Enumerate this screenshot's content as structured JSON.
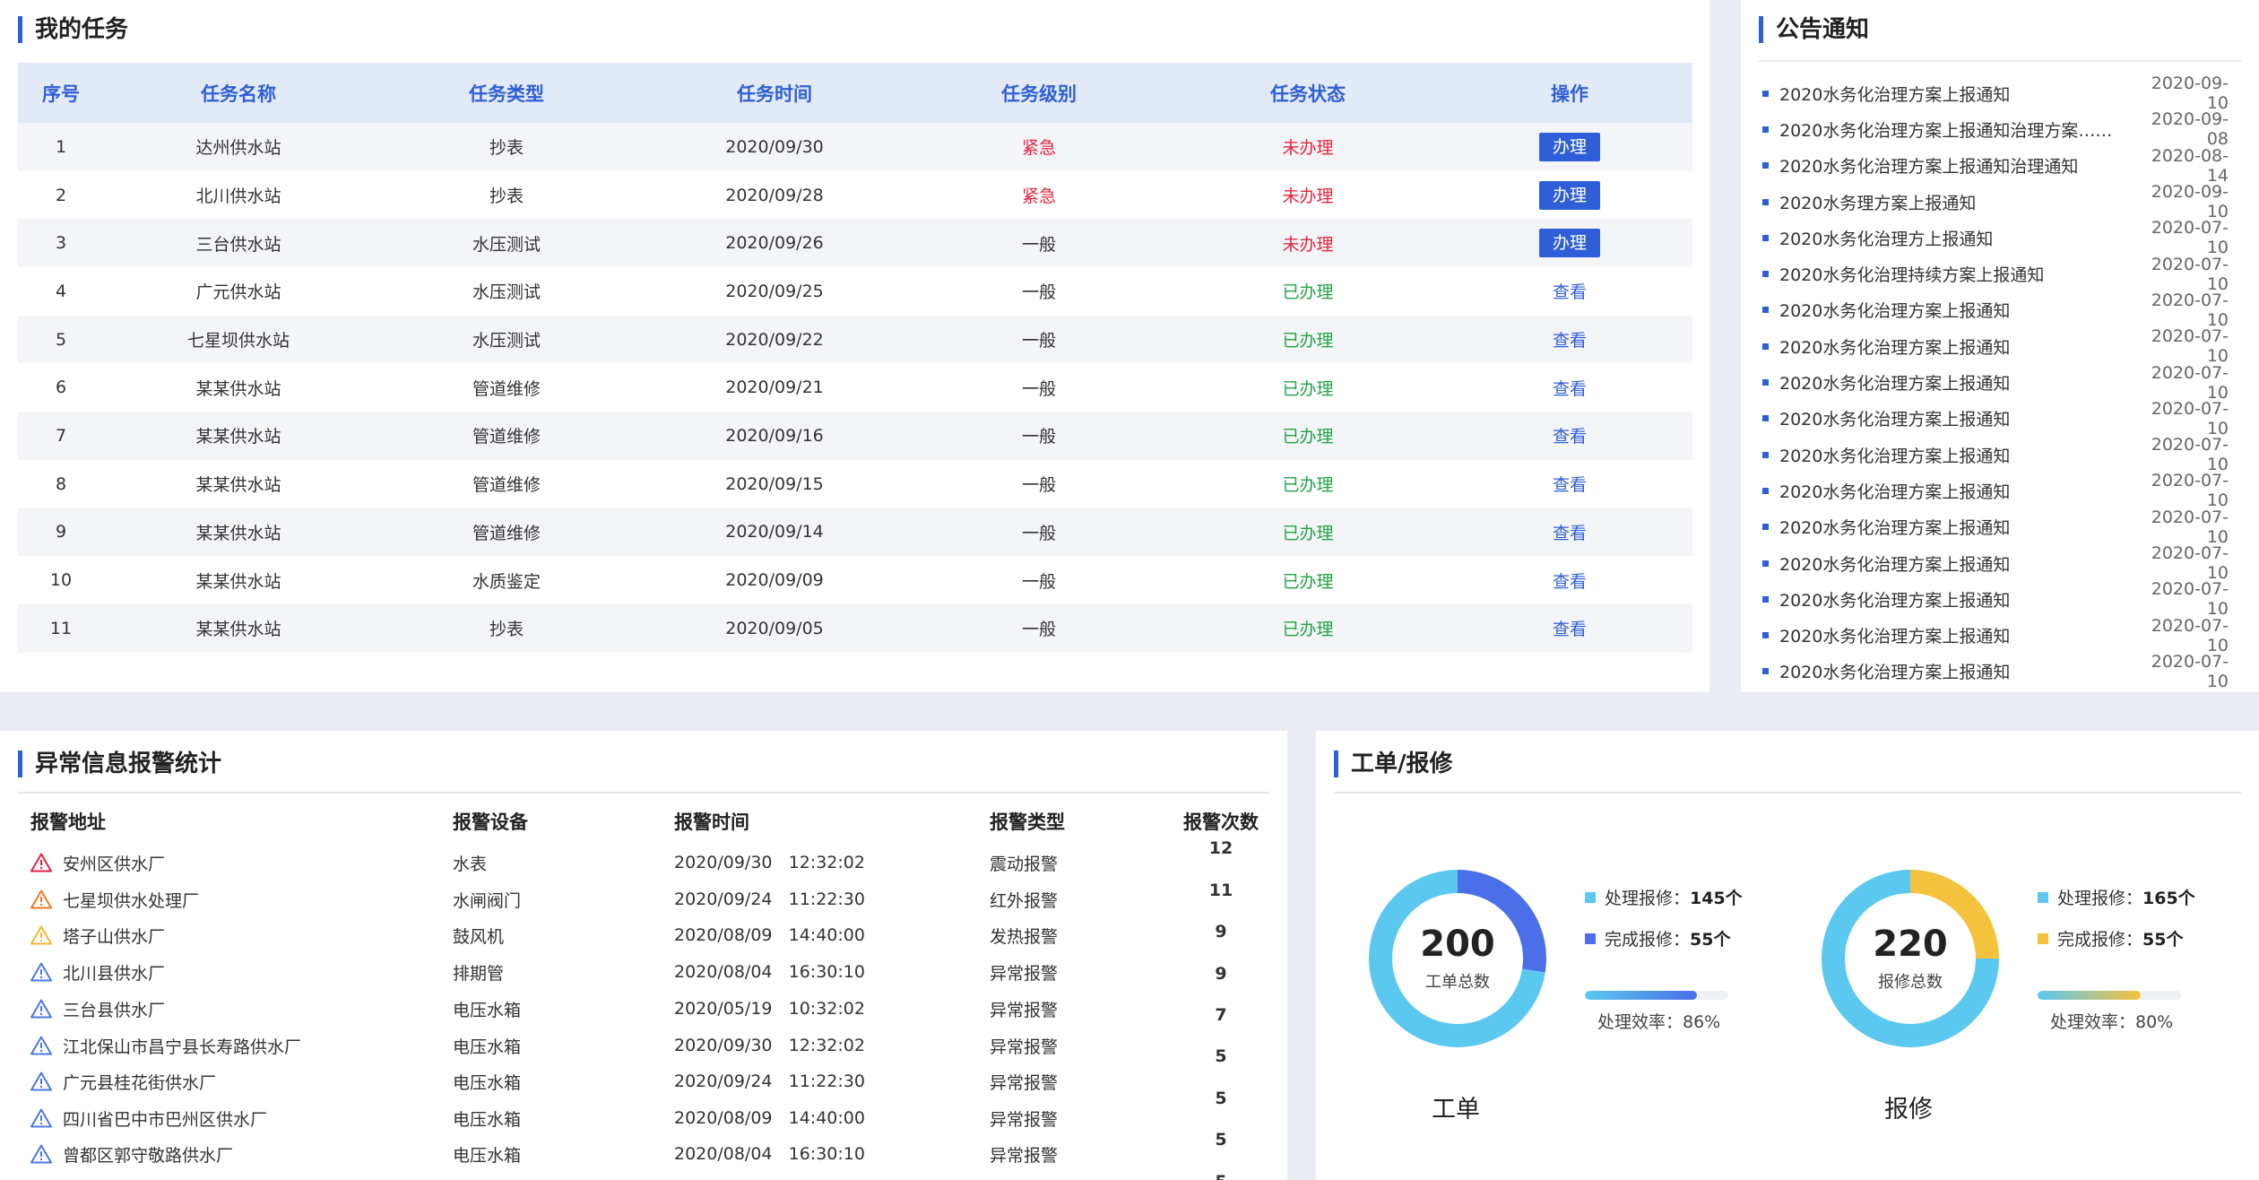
{
  "tasks": {
    "title": "我的任务",
    "columns": [
      "序号",
      "任务名称",
      "任务类型",
      "任务时间",
      "任务级别",
      "任务状态",
      "操作"
    ],
    "rows": [
      {
        "no": "1",
        "name": "达州供水站",
        "type": "抄表",
        "time": "2020/09/30",
        "level": "紧急",
        "status": "未办理",
        "action": "办理"
      },
      {
        "no": "2",
        "name": "北川供水站",
        "type": "抄表",
        "time": "2020/09/28",
        "level": "紧急",
        "status": "未办理",
        "action": "办理"
      },
      {
        "no": "3",
        "name": "三台供水站",
        "type": "水压测试",
        "time": "2020/09/26",
        "level": "一般",
        "status": "未办理",
        "action": "办理"
      },
      {
        "no": "4",
        "name": "广元供水站",
        "type": "水压测试",
        "time": "2020/09/25",
        "level": "一般",
        "status": "已办理",
        "action": "查看"
      },
      {
        "no": "5",
        "name": "七星坝供水站",
        "type": "水压测试",
        "time": "2020/09/22",
        "level": "一般",
        "status": "已办理",
        "action": "查看"
      },
      {
        "no": "6",
        "name": "某某供水站",
        "type": "管道维修",
        "time": "2020/09/21",
        "level": "一般",
        "status": "已办理",
        "action": "查看"
      },
      {
        "no": "7",
        "name": "某某供水站",
        "type": "管道维修",
        "time": "2020/09/16",
        "level": "一般",
        "status": "已办理",
        "action": "查看"
      },
      {
        "no": "8",
        "name": "某某供水站",
        "type": "管道维修",
        "time": "2020/09/15",
        "level": "一般",
        "status": "已办理",
        "action": "查看"
      },
      {
        "no": "9",
        "name": "某某供水站",
        "type": "管道维修",
        "time": "2020/09/14",
        "level": "一般",
        "status": "已办理",
        "action": "查看"
      },
      {
        "no": "10",
        "name": "某某供水站",
        "type": "水质鉴定",
        "time": "2020/09/09",
        "level": "一般",
        "status": "已办理",
        "action": "查看"
      },
      {
        "no": "11",
        "name": "某某供水站",
        "type": "抄表",
        "time": "2020/09/05",
        "level": "一般",
        "status": "已办理",
        "action": "查看"
      }
    ]
  },
  "notices": {
    "title": "公告通知",
    "items": [
      {
        "title": "2020水务化治理方案上报通知",
        "date": "2020-09-10"
      },
      {
        "title": "2020水务化治理方案上报通知治理方案……",
        "date": "2020-09-08"
      },
      {
        "title": "2020水务化治理方案上报通知治理通知",
        "date": "2020-08-14"
      },
      {
        "title": "2020水务理方案上报通知",
        "date": "2020-09-10"
      },
      {
        "title": "2020水务化治理方上报通知",
        "date": "2020-07-10"
      },
      {
        "title": "2020水务化治理持续方案上报通知",
        "date": "2020-07-10"
      },
      {
        "title": "2020水务化治理方案上报通知",
        "date": "2020-07-10"
      },
      {
        "title": "2020水务化治理方案上报通知",
        "date": "2020-07-10"
      },
      {
        "title": "2020水务化治理方案上报通知",
        "date": "2020-07-10"
      },
      {
        "title": "2020水务化治理方案上报通知",
        "date": "2020-07-10"
      },
      {
        "title": "2020水务化治理方案上报通知",
        "date": "2020-07-10"
      },
      {
        "title": "2020水务化治理方案上报通知",
        "date": "2020-07-10"
      },
      {
        "title": "2020水务化治理方案上报通知",
        "date": "2020-07-10"
      },
      {
        "title": "2020水务化治理方案上报通知",
        "date": "2020-07-10"
      },
      {
        "title": "2020水务化治理方案上报通知",
        "date": "2020-07-10"
      },
      {
        "title": "2020水务化治理方案上报通知",
        "date": "2020-07-10"
      },
      {
        "title": "2020水务化治理方案上报通知",
        "date": "2020-07-10"
      }
    ]
  },
  "alarms": {
    "title": "异常信息报警统计",
    "columns": [
      "报警地址",
      "报警设备",
      "报警时间",
      "报警类型",
      "报警次数"
    ],
    "rows": [
      {
        "address": "安州区供水厂",
        "device": "水表",
        "time": "2020/09/30   12:32:02",
        "type": "震动报警",
        "count": "12",
        "icon": "warning-red-icon"
      },
      {
        "address": "七星坝供水处理厂",
        "device": "水闸阀门",
        "time": "2020/09/24   11:22:30",
        "type": "红外报警",
        "count": "11",
        "icon": "warning-orange-icon"
      },
      {
        "address": "塔子山供水厂",
        "device": "鼓风机",
        "time": "2020/08/09   14:40:00",
        "type": "发热报警",
        "count": "9",
        "icon": "warning-yellow-icon"
      },
      {
        "address": "北川县供水厂",
        "device": "排期管",
        "time": "2020/08/04   16:30:10",
        "type": "异常报警",
        "count": "9",
        "icon": "warning-blue-icon"
      },
      {
        "address": "三台县供水厂",
        "device": "电压水箱",
        "time": "2020/05/19   10:32:02",
        "type": "异常报警",
        "count": "7",
        "icon": "warning-blue-icon"
      },
      {
        "address": "江北保山市昌宁县长寿路供水厂",
        "device": "电压水箱",
        "time": "2020/09/30   12:32:02",
        "type": "异常报警",
        "count": "5",
        "icon": "warning-blue-icon"
      },
      {
        "address": "广元县桂花街供水厂",
        "device": "电压水箱",
        "time": "2020/09/24   11:22:30",
        "type": "异常报警",
        "count": "5",
        "icon": "warning-blue-icon"
      },
      {
        "address": "四川省巴中市巴州区供水厂",
        "device": "电压水箱",
        "time": "2020/08/09   14:40:00",
        "type": "异常报警",
        "count": "5",
        "icon": "warning-blue-icon"
      },
      {
        "address": "曾都区郭守敬路供水厂",
        "device": "电压水箱",
        "time": "2020/08/04   16:30:10",
        "type": "异常报警",
        "count": "5",
        "icon": "warning-blue-icon"
      }
    ]
  },
  "workorders": {
    "title": "工单/报修",
    "cards": [
      {
        "label": "工单",
        "total": "200",
        "total_label": "工单总数",
        "legend": [
          {
            "name": "处理报修：",
            "value": "145个",
            "color": "#5bc8f0"
          },
          {
            "name": "完成报修：",
            "value": "55个",
            "color": "#4a6fe8"
          }
        ],
        "efficiency_text": "处理效率：86%",
        "efficiency": 0.78,
        "ring": {
          "processing": 145,
          "completed": 55,
          "colors": [
            "#5bc8f0",
            "#4a6fe8"
          ]
        }
      },
      {
        "label": "报修",
        "total": "220",
        "total_label": "报修总数",
        "legend": [
          {
            "name": "处理报修：",
            "value": "165个",
            "color": "#5bc8f0"
          },
          {
            "name": "完成报修：",
            "value": "55个",
            "color": "#f5c23e"
          }
        ],
        "efficiency_text": "处理效率：80%",
        "efficiency": 0.72,
        "ring": {
          "processing": 165,
          "completed": 55,
          "colors": [
            "#5bc8f0",
            "#f5c23e"
          ]
        }
      }
    ]
  },
  "colors": {
    "accent": "#2f5fd8",
    "urgent": "#e5233f",
    "done": "#1fa246"
  }
}
